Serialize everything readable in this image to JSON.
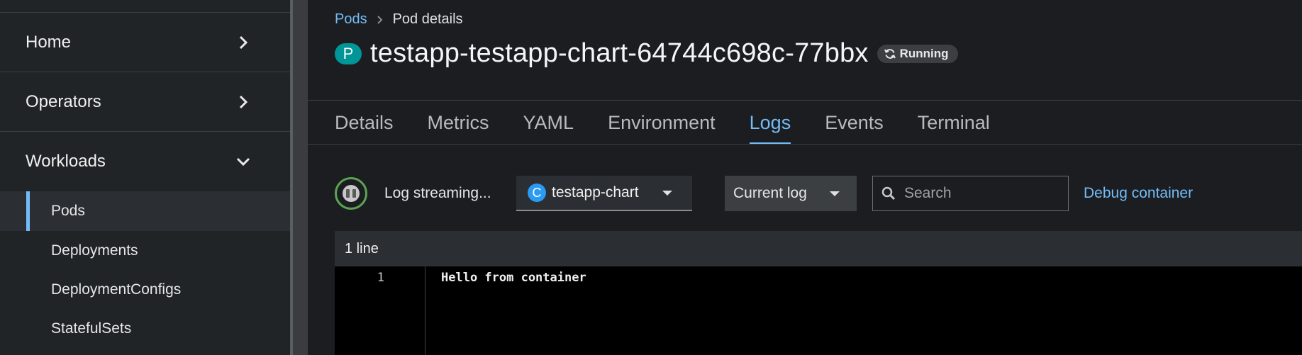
{
  "sidebar": {
    "groups": [
      {
        "label": "Home"
      },
      {
        "label": "Operators"
      },
      {
        "label": "Workloads"
      }
    ],
    "workloads_items": [
      {
        "label": "Pods"
      },
      {
        "label": "Deployments"
      },
      {
        "label": "DeploymentConfigs"
      },
      {
        "label": "StatefulSets"
      }
    ]
  },
  "breadcrumb": {
    "parent": "Pods",
    "current": "Pod details"
  },
  "pod": {
    "badge": "P",
    "name": "testapp-testapp-chart-64744c698c-77bbx",
    "status": "Running"
  },
  "tabs": [
    {
      "label": "Details"
    },
    {
      "label": "Metrics"
    },
    {
      "label": "YAML"
    },
    {
      "label": "Environment"
    },
    {
      "label": "Logs"
    },
    {
      "label": "Events"
    },
    {
      "label": "Terminal"
    }
  ],
  "active_tab": "Logs",
  "toolbar": {
    "stream_label": "Log streaming...",
    "container_badge": "C",
    "container": "testapp-chart",
    "log_type": "Current log",
    "search_placeholder": "Search",
    "debug_label": "Debug container"
  },
  "log": {
    "line_count": "1 line",
    "lines": [
      {
        "num": "1",
        "text": "Hello from container"
      }
    ]
  },
  "colors": {
    "accent": "#73bcf7",
    "pod_badge": "#009596",
    "container_badge": "#2b9af3",
    "streaming_ring": "#5ba352"
  },
  "icons": {
    "nav_collapsed": "chevron-right-icon",
    "nav_expanded": "chevron-down-icon",
    "status": "sync-icon",
    "search": "search-icon",
    "stream": "pause-icon"
  }
}
